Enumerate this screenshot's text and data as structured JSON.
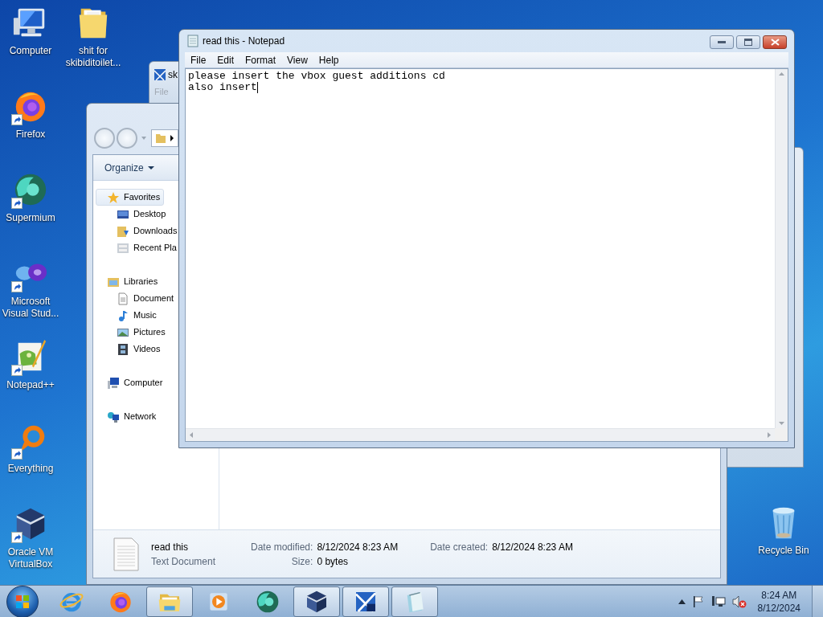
{
  "desktop_icons": [
    {
      "label": "Computer",
      "kind": "computer",
      "shortcut": false
    },
    {
      "label": "Firefox",
      "kind": "firefox",
      "shortcut": true
    },
    {
      "label": "Supermium",
      "kind": "supermium",
      "shortcut": true
    },
    {
      "label": "Microsoft Visual Stud...",
      "kind": "vs",
      "shortcut": true
    },
    {
      "label": "Notepad++",
      "kind": "notepadpp",
      "shortcut": true
    },
    {
      "label": "Everything",
      "kind": "everything",
      "shortcut": true
    },
    {
      "label": "Oracle VM VirtualBox",
      "kind": "virtualbox",
      "shortcut": true
    },
    {
      "label": "shit for skibiditoilet...",
      "kind": "folder",
      "shortcut": false
    }
  ],
  "recycle_bin": {
    "label": "Recycle Bin"
  },
  "background_window": {
    "title": "sk",
    "menu": "File"
  },
  "explorer": {
    "organize": "Organize",
    "nav": [
      {
        "label": "Favorites",
        "kind": "star",
        "selected": true,
        "children": [
          {
            "label": "Desktop",
            "kind": "desktop",
            "selected": false
          },
          {
            "label": "Downloads",
            "kind": "downloads",
            "selected": false
          },
          {
            "label": "Recent Pla",
            "kind": "recent",
            "selected": false
          }
        ]
      },
      {
        "label": "Libraries",
        "kind": "libraries",
        "selected": false,
        "children": [
          {
            "label": "Document",
            "kind": "document",
            "selected": false
          },
          {
            "label": "Music",
            "kind": "music",
            "selected": false
          },
          {
            "label": "Pictures",
            "kind": "pictures",
            "selected": false
          },
          {
            "label": "Videos",
            "kind": "videos",
            "selected": false
          }
        ]
      },
      {
        "label": "Computer",
        "kind": "computer",
        "selected": false
      },
      {
        "label": "Network",
        "kind": "network",
        "selected": false
      }
    ],
    "details": {
      "name": "read this",
      "type": "Text Document",
      "field_rows": [
        [
          {
            "label": "Date modified:",
            "value": "8/12/2024 8:23 AM"
          },
          {
            "label": "Date created:",
            "value": "8/12/2024 8:23 AM"
          }
        ],
        [
          {
            "label": "Size:",
            "value": "0 bytes"
          }
        ]
      ]
    }
  },
  "notepad": {
    "title": "read this - Notepad",
    "menu": [
      "File",
      "Edit",
      "Format",
      "View",
      "Help"
    ],
    "lines": [
      "please insert the vbox guest additions cd",
      "also insert"
    ]
  },
  "taskbar": {
    "apps": [
      {
        "kind": "ie",
        "active": false
      },
      {
        "kind": "firefox",
        "active": false
      },
      {
        "kind": "explorer",
        "active": true
      },
      {
        "kind": "media",
        "active": false
      },
      {
        "kind": "supermium",
        "active": false
      },
      {
        "kind": "virtualbox",
        "active": true
      },
      {
        "kind": "xp",
        "active": true
      },
      {
        "kind": "notepad",
        "active": true
      }
    ],
    "time": "8:24 AM",
    "date": "8/12/2024"
  }
}
